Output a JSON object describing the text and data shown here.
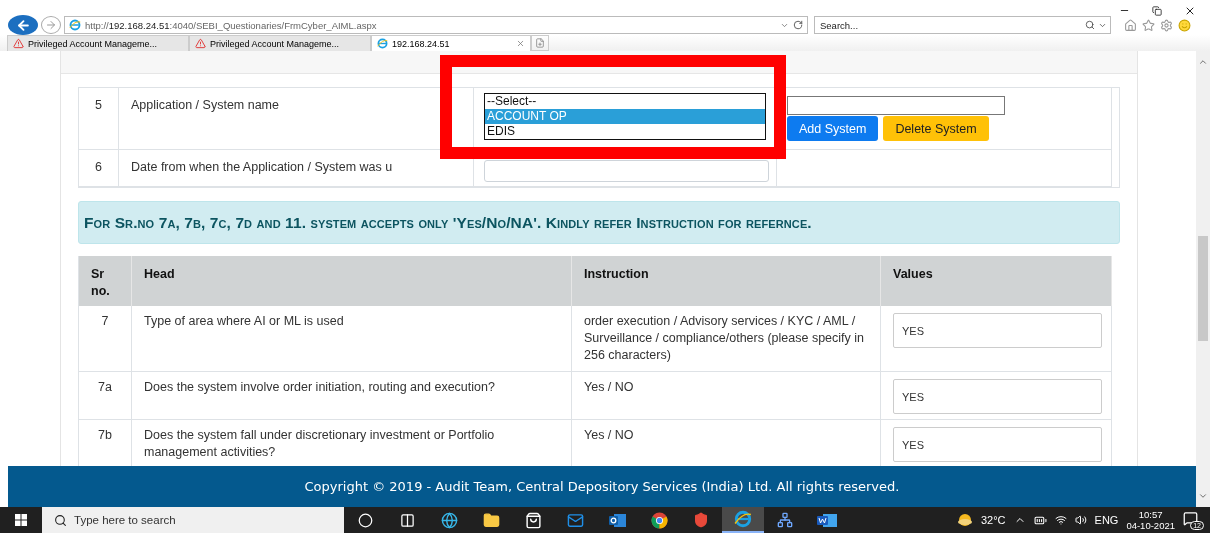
{
  "browser": {
    "url": "http://**192.168.24.51**:4040/SEBI_Questionaries/FrmCyber_AIML.aspx",
    "search": {
      "placeholder": "Search..."
    },
    "tabs": [
      {
        "label": "Privileged Account Manageme...",
        "kind": "warning",
        "selected": false
      },
      {
        "label": "Privileged Account Manageme...",
        "kind": "warning",
        "selected": false
      },
      {
        "label": "192.168.24.51",
        "kind": "browser",
        "selected": true
      }
    ]
  },
  "form_rows": [
    {
      "number": "5",
      "label": "Application / System name"
    },
    {
      "number": "6",
      "label": "Date from when the Application / System was u"
    }
  ],
  "system_select": {
    "options": [
      {
        "label": "--Select--",
        "selected": false
      },
      {
        "label": "ACCOUNT OP",
        "selected": true
      },
      {
        "label": "EDIS",
        "selected": false
      }
    ]
  },
  "system_buttons": [
    {
      "label": "Add System",
      "kind": "primary"
    },
    {
      "label": "Delete System",
      "kind": "warning"
    }
  ],
  "notice": "For Sr.no 7a, 7b, 7c, 7d and 11. system accepts only 'Yes/No/NA'. Kindly refer Instruction for refernce.",
  "table": {
    "columns": [
      "Sr no.",
      "Head",
      "Instruction",
      "Values"
    ],
    "rows": [
      {
        "number": "7",
        "head": "Type of area where AI or ML is used",
        "instruction": "order execution / Advisory services / KYC / AML / Surveillance / compliance/others (please specify in 256 characters)",
        "value": "YES"
      },
      {
        "number": "7a",
        "head": "Does the system involve order initiation, routing and execution?",
        "instruction": "Yes / NO",
        "value": "YES"
      },
      {
        "number": "7b",
        "head": "Does the system fall under discretionary investment or Portfolio management activities?",
        "instruction": "Yes / NO",
        "value": "YES"
      }
    ]
  },
  "footer": "Copyright © 2019 - Audit Team, Central Depository Services (India) Ltd. All rights reserved.",
  "taskbar": {
    "search": {
      "placeholder": "Type here to search"
    },
    "apps": [
      {
        "kind": "cortana",
        "active": false
      },
      {
        "kind": "taskview",
        "active": false
      },
      {
        "kind": "edge",
        "active": false
      },
      {
        "kind": "folder",
        "active": false
      },
      {
        "kind": "store",
        "active": false
      },
      {
        "kind": "mail",
        "active": false
      },
      {
        "kind": "outlook",
        "active": false
      },
      {
        "kind": "chrome",
        "active": false
      },
      {
        "kind": "shield",
        "active": false
      },
      {
        "kind": "ie",
        "active": true
      },
      {
        "kind": "network",
        "active": false
      },
      {
        "kind": "word",
        "active": false
      }
    ],
    "weather": "32°C",
    "language": "ENG",
    "time": "10:57",
    "date": "04-10-2021",
    "notifications": "12"
  }
}
